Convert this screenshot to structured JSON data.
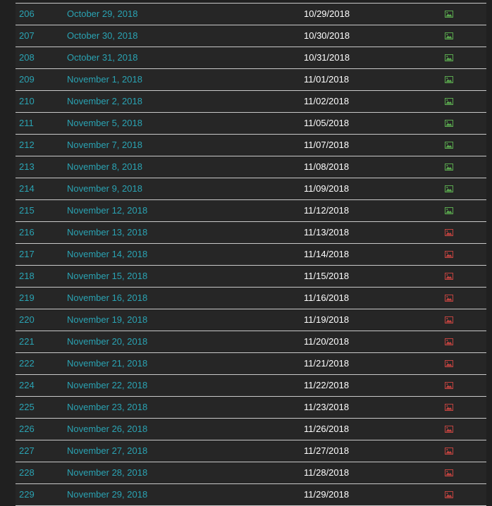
{
  "rows": [
    {
      "id": "206",
      "title": "October 29, 2018",
      "date": "10/29/2018",
      "icon": "image-icon-green"
    },
    {
      "id": "207",
      "title": "October 30, 2018",
      "date": "10/30/2018",
      "icon": "image-icon-green"
    },
    {
      "id": "208",
      "title": "October 31, 2018",
      "date": "10/31/2018",
      "icon": "image-icon-green"
    },
    {
      "id": "209",
      "title": "November 1, 2018",
      "date": "11/01/2018",
      "icon": "image-icon-green"
    },
    {
      "id": "210",
      "title": "November 2, 2018",
      "date": "11/02/2018",
      "icon": "image-icon-green"
    },
    {
      "id": "211",
      "title": "November 5, 2018",
      "date": "11/05/2018",
      "icon": "image-icon-green"
    },
    {
      "id": "212",
      "title": "November 7, 2018",
      "date": "11/07/2018",
      "icon": "image-icon-green"
    },
    {
      "id": "213",
      "title": "November 8, 2018",
      "date": "11/08/2018",
      "icon": "image-icon-green"
    },
    {
      "id": "214",
      "title": "November 9, 2018",
      "date": "11/09/2018",
      "icon": "image-icon-green"
    },
    {
      "id": "215",
      "title": "November 12, 2018",
      "date": "11/12/2018",
      "icon": "image-icon-green"
    },
    {
      "id": "216",
      "title": "November 13, 2018",
      "date": "11/13/2018",
      "icon": "image-icon-red"
    },
    {
      "id": "217",
      "title": "November 14, 2018",
      "date": "11/14/2018",
      "icon": "image-icon-red"
    },
    {
      "id": "218",
      "title": "November 15, 2018",
      "date": "11/15/2018",
      "icon": "image-icon-red"
    },
    {
      "id": "219",
      "title": "November 16, 2018",
      "date": "11/16/2018",
      "icon": "image-icon-red"
    },
    {
      "id": "220",
      "title": "November 19, 2018",
      "date": "11/19/2018",
      "icon": "image-icon-red"
    },
    {
      "id": "221",
      "title": "November 20, 2018",
      "date": "11/20/2018",
      "icon": "image-icon-red"
    },
    {
      "id": "222",
      "title": "November 21, 2018",
      "date": "11/21/2018",
      "icon": "image-icon-red"
    },
    {
      "id": "224",
      "title": "November 22, 2018",
      "date": "11/22/2018",
      "icon": "image-icon-red"
    },
    {
      "id": "225",
      "title": "November 23, 2018",
      "date": "11/23/2018",
      "icon": "image-icon-red"
    },
    {
      "id": "226",
      "title": "November 26, 2018",
      "date": "11/26/2018",
      "icon": "image-icon-red"
    },
    {
      "id": "227",
      "title": "November 27, 2018",
      "date": "11/27/2018",
      "icon": "image-icon-red"
    },
    {
      "id": "228",
      "title": "November 28, 2018",
      "date": "11/28/2018",
      "icon": "image-icon-red"
    },
    {
      "id": "229",
      "title": "November 29, 2018",
      "date": "11/29/2018",
      "icon": "image-icon-red"
    }
  ],
  "colors": {
    "link": "#2aa3b3",
    "icon_green": "#5aa84e",
    "icon_red": "#c0433f",
    "row_bg": "#262626",
    "border": "#c9c9c9",
    "text": "#ffffff"
  }
}
